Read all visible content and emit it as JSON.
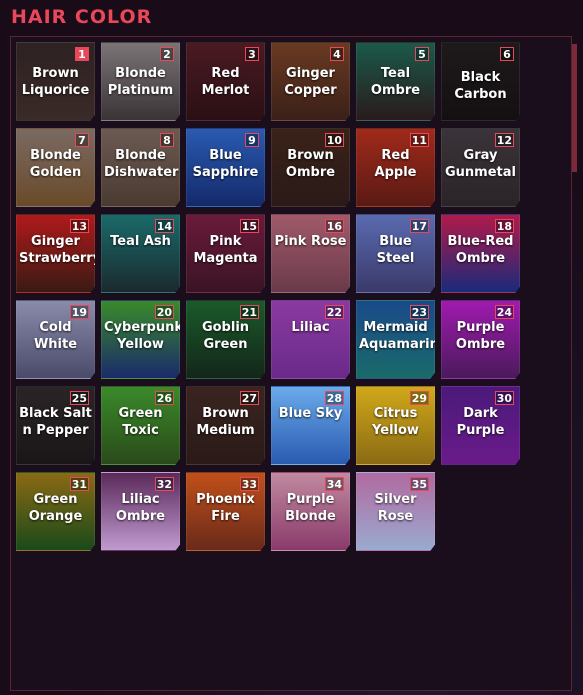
{
  "header": {
    "title": "HAIR COLOR"
  },
  "tiles": [
    {
      "n": "1",
      "label": "Brown Liquorice",
      "bg": "linear-gradient(180deg,#2e2222,#3a2a28)"
    },
    {
      "n": "2",
      "label": "Blonde Platinum",
      "bg": "linear-gradient(180deg,#7a7476,#3a3436)"
    },
    {
      "n": "3",
      "label": "Red Merlot",
      "bg": "linear-gradient(180deg,#4a1a22,#2a1014)"
    },
    {
      "n": "4",
      "label": "Ginger Copper",
      "bg": "linear-gradient(180deg,#6a3a22,#3a2018)"
    },
    {
      "n": "5",
      "label": "Teal Ombre",
      "bg": "linear-gradient(180deg,#1a5a4a,#2a1a1c)"
    },
    {
      "n": "6",
      "label": "Black Carbon",
      "bg": "linear-gradient(180deg,#1e1a1c,#141012)"
    },
    {
      "n": "7",
      "label": "Blonde Golden",
      "bg": "linear-gradient(180deg,#7a6a62,#6a4a2a)"
    },
    {
      "n": "8",
      "label": "Blonde Dishwater",
      "bg": "linear-gradient(180deg,#6a5a52,#4a3a30)"
    },
    {
      "n": "9",
      "label": "Blue Sapphire",
      "bg": "linear-gradient(180deg,#2a5ab0,#142a6a)"
    },
    {
      "n": "10",
      "label": "Brown Ombre",
      "bg": "linear-gradient(180deg,#3a2218,#2a1a18)"
    },
    {
      "n": "11",
      "label": "Red Apple",
      "bg": "linear-gradient(180deg,#a02a1a,#5a1a14)"
    },
    {
      "n": "12",
      "label": "Gray Gunmetal",
      "bg": "linear-gradient(180deg,#3a343a,#2a2428)"
    },
    {
      "n": "13",
      "label": "Ginger Strawberry",
      "bg": "linear-gradient(180deg,#b01a1a,#3a1a14)"
    },
    {
      "n": "14",
      "label": "Teal Ash",
      "bg": "linear-gradient(180deg,#1a6a6a,#1a2a2e)"
    },
    {
      "n": "15",
      "label": "Pink Magenta",
      "bg": "linear-gradient(180deg,#6a1a3a,#3a1424)"
    },
    {
      "n": "16",
      "label": "Pink Rose",
      "bg": "linear-gradient(180deg,#a05a6a,#6a3a4a)"
    },
    {
      "n": "17",
      "label": "Blue Steel",
      "bg": "linear-gradient(180deg,#5a6ab0,#3a3a6a)"
    },
    {
      "n": "18",
      "label": "Blue-Red Ombre",
      "bg": "linear-gradient(180deg,#b01a4a,#1a2a7a)"
    },
    {
      "n": "19",
      "label": "Cold White",
      "bg": "linear-gradient(180deg,#8a8aaa,#4a4a6a)"
    },
    {
      "n": "20",
      "label": "Cyberpunk Yellow",
      "bg": "linear-gradient(180deg,#3a8a2a,#1a2a6a)"
    },
    {
      "n": "21",
      "label": "Goblin Green",
      "bg": "linear-gradient(180deg,#1a5a2a,#14261a)"
    },
    {
      "n": "22",
      "label": "Liliac",
      "bg": "linear-gradient(180deg,#8a3aa0,#6a2a8a)"
    },
    {
      "n": "23",
      "label": "Mermaid Aquamarine",
      "bg": "linear-gradient(180deg,#1a4a8a,#1a6a6a)"
    },
    {
      "n": "24",
      "label": "Purple Ombre",
      "bg": "linear-gradient(180deg,#a01ab0,#4a1a5a)"
    },
    {
      "n": "25",
      "label": "Black Salt n Pepper",
      "bg": "linear-gradient(180deg,#2a2426,#1a1618)"
    },
    {
      "n": "26",
      "label": "Green Toxic",
      "bg": "linear-gradient(180deg,#3a8a2a,#2a4a1a)"
    },
    {
      "n": "27",
      "label": "Brown Medium",
      "bg": "linear-gradient(180deg,#3a2420,#2a1a18)"
    },
    {
      "n": "28",
      "label": "Blue Sky",
      "bg": "linear-gradient(180deg,#6aaaea,#2a5ab0)"
    },
    {
      "n": "29",
      "label": "Citrus Yellow",
      "bg": "linear-gradient(180deg,#d0a81a,#8a6a14)"
    },
    {
      "n": "30",
      "label": "Dark Purple",
      "bg": "linear-gradient(180deg,#4a1a7a,#6a1a8a)"
    },
    {
      "n": "31",
      "label": "Green Orange",
      "bg": "linear-gradient(180deg,#8a6a14,#1a4a1a)"
    },
    {
      "n": "32",
      "label": "Liliac Ombre",
      "bg": "linear-gradient(180deg,#5a2a5a,#c09ad0)"
    },
    {
      "n": "33",
      "label": "Phoenix Fire",
      "bg": "linear-gradient(180deg,#c0501a,#6a2a1a)"
    },
    {
      "n": "34",
      "label": "Purple Blonde",
      "bg": "linear-gradient(180deg,#c08aa0,#8a3a6a)"
    },
    {
      "n": "35",
      "label": "Silver Rose",
      "bg": "linear-gradient(180deg,#b06aa0,#9aaad0)"
    }
  ]
}
